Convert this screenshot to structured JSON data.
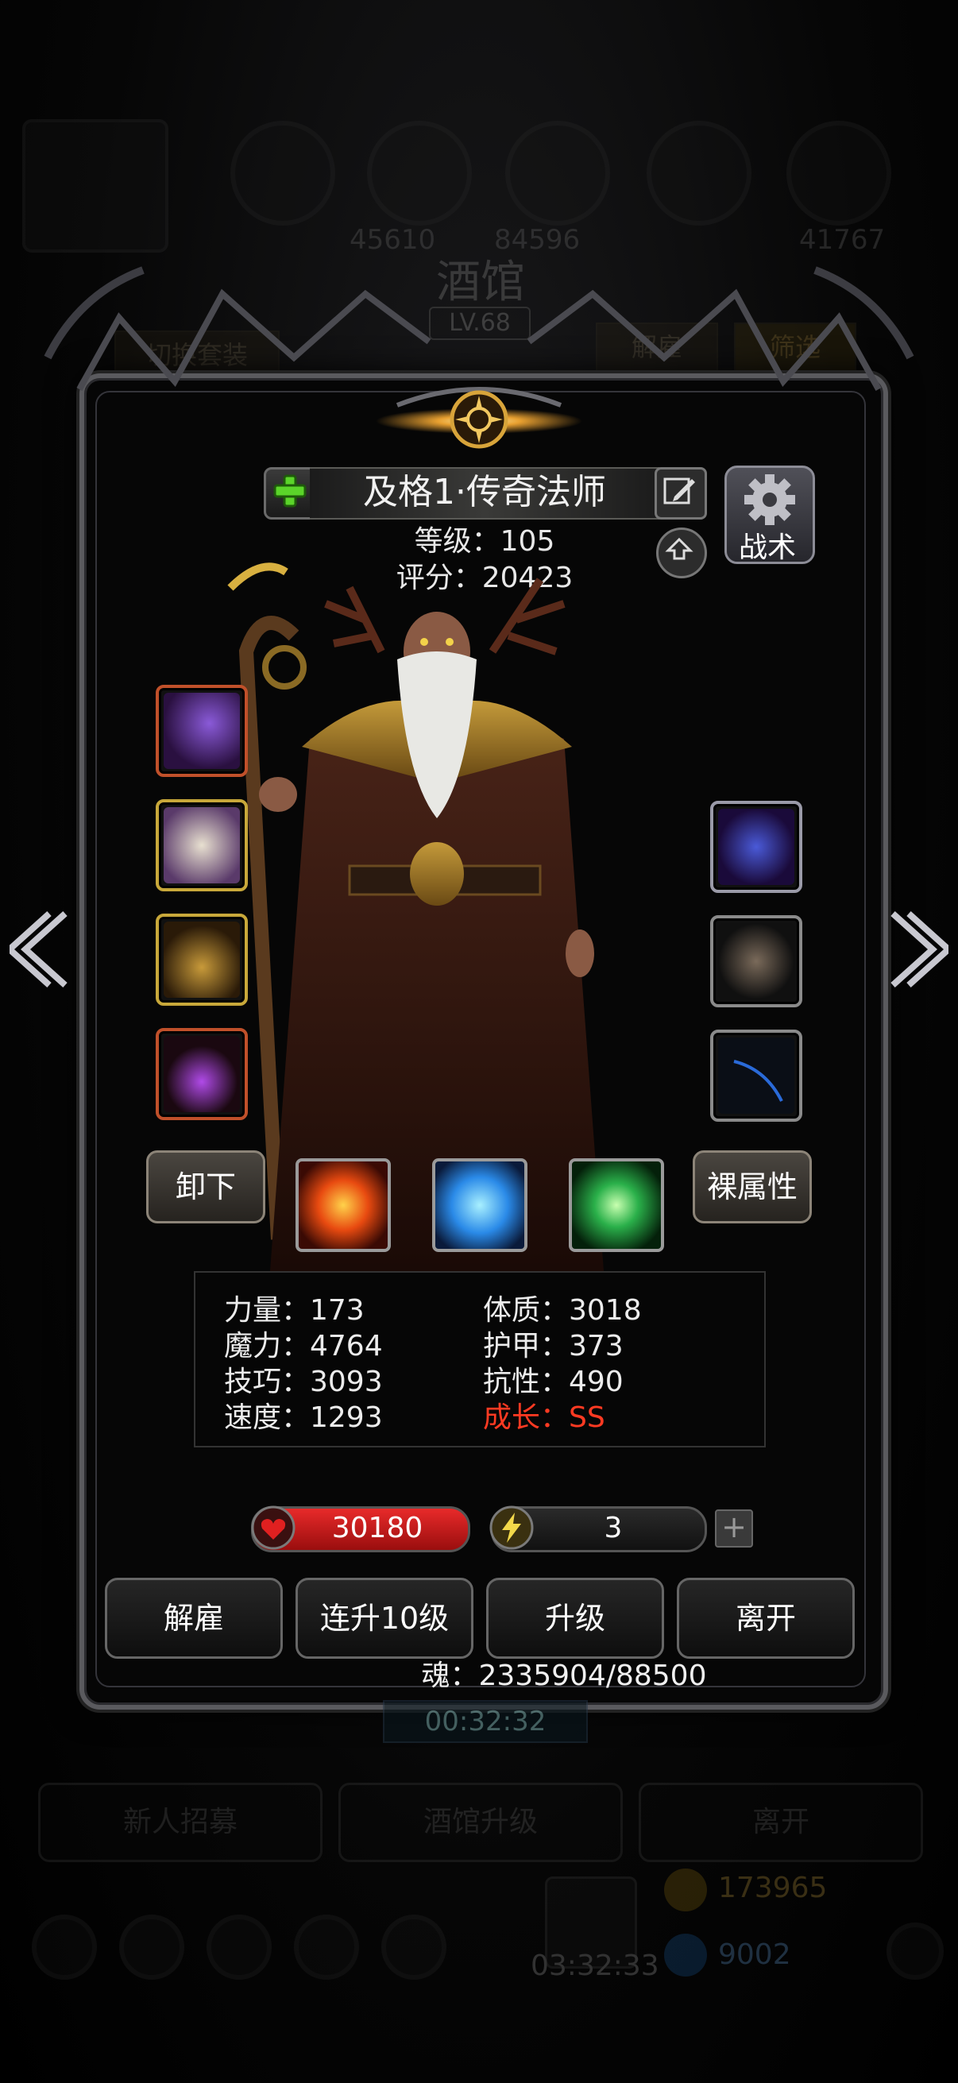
{
  "background": {
    "title": "酒馆",
    "level": "LV.68",
    "switch_outfit": "切换套装",
    "dismiss": "解雇",
    "filter": "筛选",
    "timer": "00:32:32",
    "bottom_buttons": [
      "新人招募",
      "酒馆升级",
      "离开"
    ],
    "bottom_timer": "03:32:33",
    "gold": "173965",
    "gems": "9002",
    "top_numbers": [
      "45610",
      "84596",
      "41767"
    ]
  },
  "hero": {
    "name": "及格1·传奇法师",
    "level_line": "等级：105",
    "score_line": "评分：20423",
    "tactics_label": "战术"
  },
  "equipment": {
    "left_slots": [
      "staff",
      "robe",
      "necklace",
      "amulet"
    ],
    "right_slots": [
      "gem",
      "bracer",
      "whip"
    ]
  },
  "actions": {
    "unequip": "卸下",
    "base_stats": "裸属性"
  },
  "skills": [
    "fire-blast",
    "ice-shards",
    "green-light"
  ],
  "stats": [
    {
      "label": "力量：173"
    },
    {
      "label": "体质：3018"
    },
    {
      "label": "魔力：4764"
    },
    {
      "label": "护甲：373"
    },
    {
      "label": "技巧：3093"
    },
    {
      "label": "抗性：490"
    },
    {
      "label": "速度：1293"
    },
    {
      "label": "成长：SS"
    }
  ],
  "bars": {
    "hp": "30180",
    "energy": "3"
  },
  "footer_buttons": [
    "解雇",
    "连升10级",
    "升级",
    "离开"
  ],
  "soul": "魂：2335904/88500",
  "colors": {
    "accent_gold": "#d8a43a",
    "hp_red": "#d11d1d",
    "growth_red": "#ff3a22"
  }
}
